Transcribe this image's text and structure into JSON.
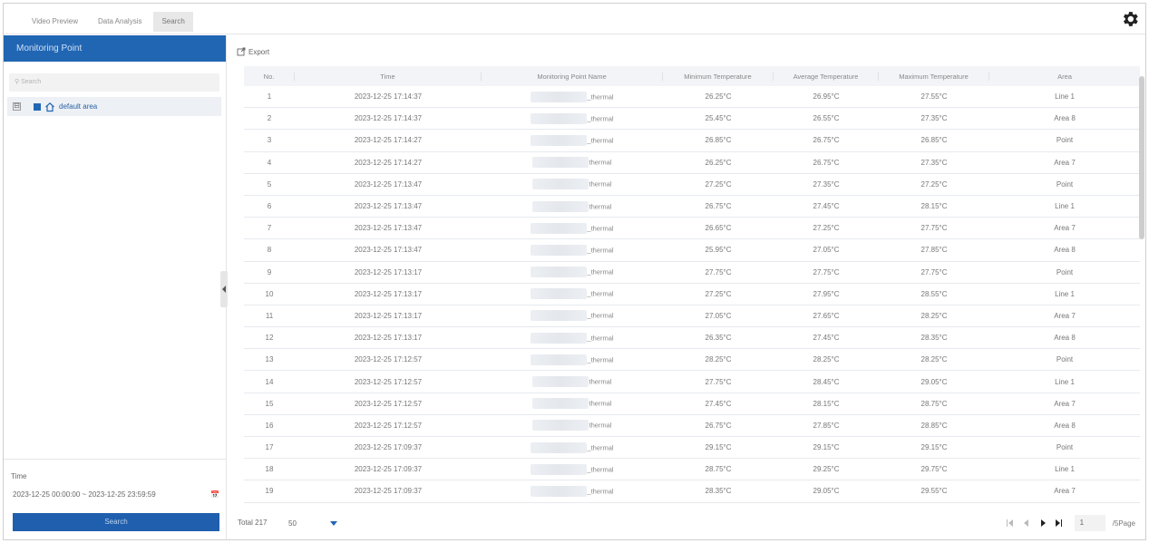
{
  "tabs": [
    {
      "label": "Video Preview"
    },
    {
      "label": "Data Analysis"
    },
    {
      "label": "Search"
    }
  ],
  "icons": {
    "settings": "gear-icon",
    "export": "export-icon",
    "home": "home-icon",
    "calendar": "calendar-icon"
  },
  "sidebar": {
    "title": "Monitoring Point",
    "search_placeholder": "Search",
    "tree": {
      "toggle": "⊟",
      "label": "default area"
    },
    "time_label": "Time",
    "time_range": "2023-12-25 00:00:00 ~ 2023-12-25 23:59:59",
    "search_button": "Search"
  },
  "toolbar": {
    "export_label": "Export"
  },
  "table": {
    "headers": [
      "No.",
      "Time",
      "Monitoring Point Name",
      "Minimum Temperature",
      "Average Temperature",
      "Maximum Temperature",
      "Area"
    ],
    "rows": [
      [
        "1",
        "2023-12-25 17:14:37",
        "_thermal",
        "26.25°C",
        "26.95°C",
        "27.55°C",
        "Line 1"
      ],
      [
        "2",
        "2023-12-25 17:14:37",
        "_thermal",
        "25.45°C",
        "26.55°C",
        "27.35°C",
        "Area 8"
      ],
      [
        "3",
        "2023-12-25 17:14:27",
        "_thermal",
        "26.85°C",
        "26.75°C",
        "26.85°C",
        "Point"
      ],
      [
        "4",
        "2023-12-25 17:14:27",
        "thermal",
        "26.25°C",
        "26.75°C",
        "27.35°C",
        "Area 7"
      ],
      [
        "5",
        "2023-12-25 17:13:47",
        "thermal",
        "27.25°C",
        "27.35°C",
        "27.25°C",
        "Point"
      ],
      [
        "6",
        "2023-12-25 17:13:47",
        "thermal",
        "26.75°C",
        "27.45°C",
        "28.15°C",
        "Line 1"
      ],
      [
        "7",
        "2023-12-25 17:13:47",
        "_thermal",
        "26.65°C",
        "27.25°C",
        "27.75°C",
        "Area 7"
      ],
      [
        "8",
        "2023-12-25 17:13:47",
        "_thermal",
        "25.95°C",
        "27.05°C",
        "27.85°C",
        "Area 8"
      ],
      [
        "9",
        "2023-12-25 17:13:17",
        "_thermal",
        "27.75°C",
        "27.75°C",
        "27.75°C",
        "Point"
      ],
      [
        "10",
        "2023-12-25 17:13:17",
        "_thermal",
        "27.25°C",
        "27.95°C",
        "28.55°C",
        "Line 1"
      ],
      [
        "11",
        "2023-12-25 17:13:17",
        "_thermal",
        "27.05°C",
        "27.65°C",
        "28.25°C",
        "Area 7"
      ],
      [
        "12",
        "2023-12-25 17:13:17",
        "_thermal",
        "26.35°C",
        "27.45°C",
        "28.35°C",
        "Area 8"
      ],
      [
        "13",
        "2023-12-25 17:12:57",
        "_thermal",
        "28.25°C",
        "28.25°C",
        "28.25°C",
        "Point"
      ],
      [
        "14",
        "2023-12-25 17:12:57",
        "thermal",
        "27.75°C",
        "28.45°C",
        "29.05°C",
        "Line 1"
      ],
      [
        "15",
        "2023-12-25 17:12:57",
        "thermal",
        "27.45°C",
        "28.15°C",
        "28.75°C",
        "Area 7"
      ],
      [
        "16",
        "2023-12-25 17:12:57",
        "thermal",
        "26.75°C",
        "27.85°C",
        "28.85°C",
        "Area 8"
      ],
      [
        "17",
        "2023-12-25 17:09:37",
        "_thermal",
        "29.15°C",
        "29.15°C",
        "29.15°C",
        "Point"
      ],
      [
        "18",
        "2023-12-25 17:09:37",
        "_thermal",
        "28.75°C",
        "29.25°C",
        "29.75°C",
        "Line 1"
      ],
      [
        "19",
        "2023-12-25 17:09:37",
        "_thermal",
        "28.35°C",
        "29.05°C",
        "29.55°C",
        "Area 7"
      ]
    ]
  },
  "footer": {
    "total_label": "Total 217",
    "page_size": "50",
    "current_page": "1",
    "page_suffix": "/5Page"
  },
  "colors": {
    "accent": "#2166b3",
    "button": "#1f5fae"
  }
}
